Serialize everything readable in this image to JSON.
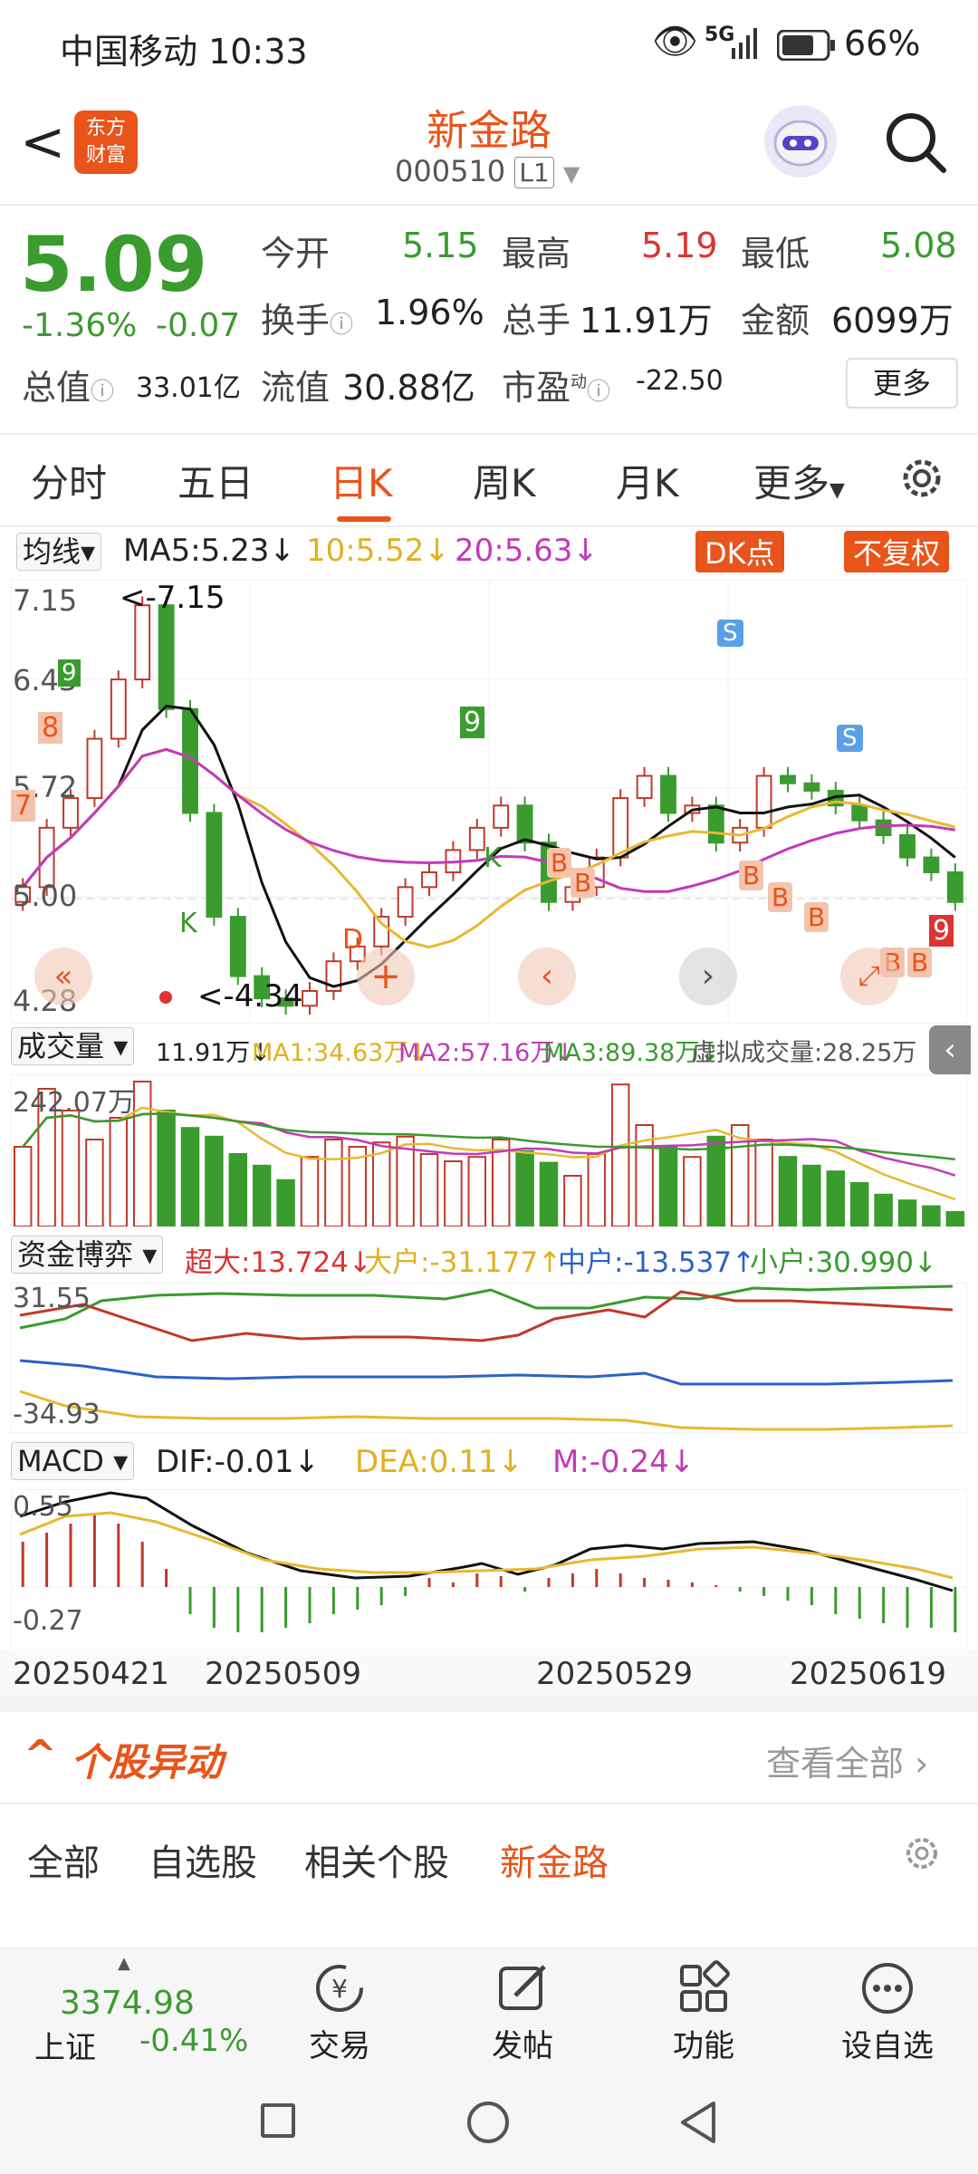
{
  "status_bar": {
    "carrier_time": "中国移动 10:33",
    "signal": "5G",
    "battery": "66%"
  },
  "header": {
    "back": "<",
    "logo_top": "东方",
    "logo_bottom": "财富",
    "title": "新金路",
    "code": "000510",
    "level": "L1"
  },
  "quote": {
    "price": "5.09",
    "change_pct": "-1.36%",
    "change": "-0.07",
    "open_label": "今开",
    "open": "5.15",
    "high_label": "最高",
    "high": "5.19",
    "low_label": "最低",
    "low": "5.08",
    "turnover_label": "换手",
    "turnover": "1.96%",
    "volume_label": "总手",
    "volume": "11.91万",
    "amount_label": "金额",
    "amount": "6099万",
    "mktcap_label": "总值",
    "mktcap": "33.01亿",
    "float_label": "流值",
    "float": "30.88亿",
    "pe_label": "市盈",
    "pe_sup": "动",
    "pe": "-22.50",
    "more_btn": "更多"
  },
  "tabs": [
    "分时",
    "五日",
    "日K",
    "周K",
    "月K",
    "更多"
  ],
  "ma_bar": {
    "selector": "均线",
    "ma5": "MA5:5.23↓",
    "ma10": "10:5.52↓",
    "ma20": "20:5.63↓",
    "dk": "DK点",
    "fq": "不复权"
  },
  "kline": {
    "y_top": "7.15",
    "y_mid1": "6.43",
    "y_mid2": "5.72",
    "y_mid3": "5.00",
    "y_bottom": "4.28",
    "high_note": "<-7.15",
    "low_note": "<-4.34"
  },
  "volume_bar": {
    "selector": "成交量",
    "v": "11.91万↓",
    "ma1": "MA1:34.63万↓",
    "ma2": "MA2:57.16万↓",
    "ma3": "MA3:89.38万↓",
    "virtual": "虚拟成交量:28.25万",
    "y_top": "242.07万"
  },
  "fund_bar": {
    "selector": "资金博弈",
    "super": "超大:13.724↓",
    "big": "大户:-31.177↑",
    "mid": "中户:-13.537↑",
    "small": "小户:30.990↓",
    "y_top": "31.55",
    "y_bottom": "-34.93"
  },
  "macd_bar": {
    "selector": "MACD",
    "dif": "DIF:-0.01↓",
    "dea": "DEA:0.11↓",
    "m": "M:-0.24↓",
    "y_top": "0.55",
    "y_bottom": "-0.27"
  },
  "dates": [
    "20250421",
    "20250509",
    "20250529",
    "20250619"
  ],
  "movement": {
    "title": "个股异动",
    "view_all": "查看全部",
    "tabs": [
      "全部",
      "自选股",
      "相关个股",
      "新金路"
    ]
  },
  "index_box": {
    "value": "3374.98",
    "name": "上证",
    "pct": "-0.41%"
  },
  "bottom_tabs": [
    "交易",
    "发帖",
    "功能",
    "设自选"
  ],
  "colors": {
    "up": "#d33",
    "down": "#3a9b2e",
    "accent": "#e8541a",
    "ma10": "#e0b020",
    "ma20": "#c23ab8"
  }
}
